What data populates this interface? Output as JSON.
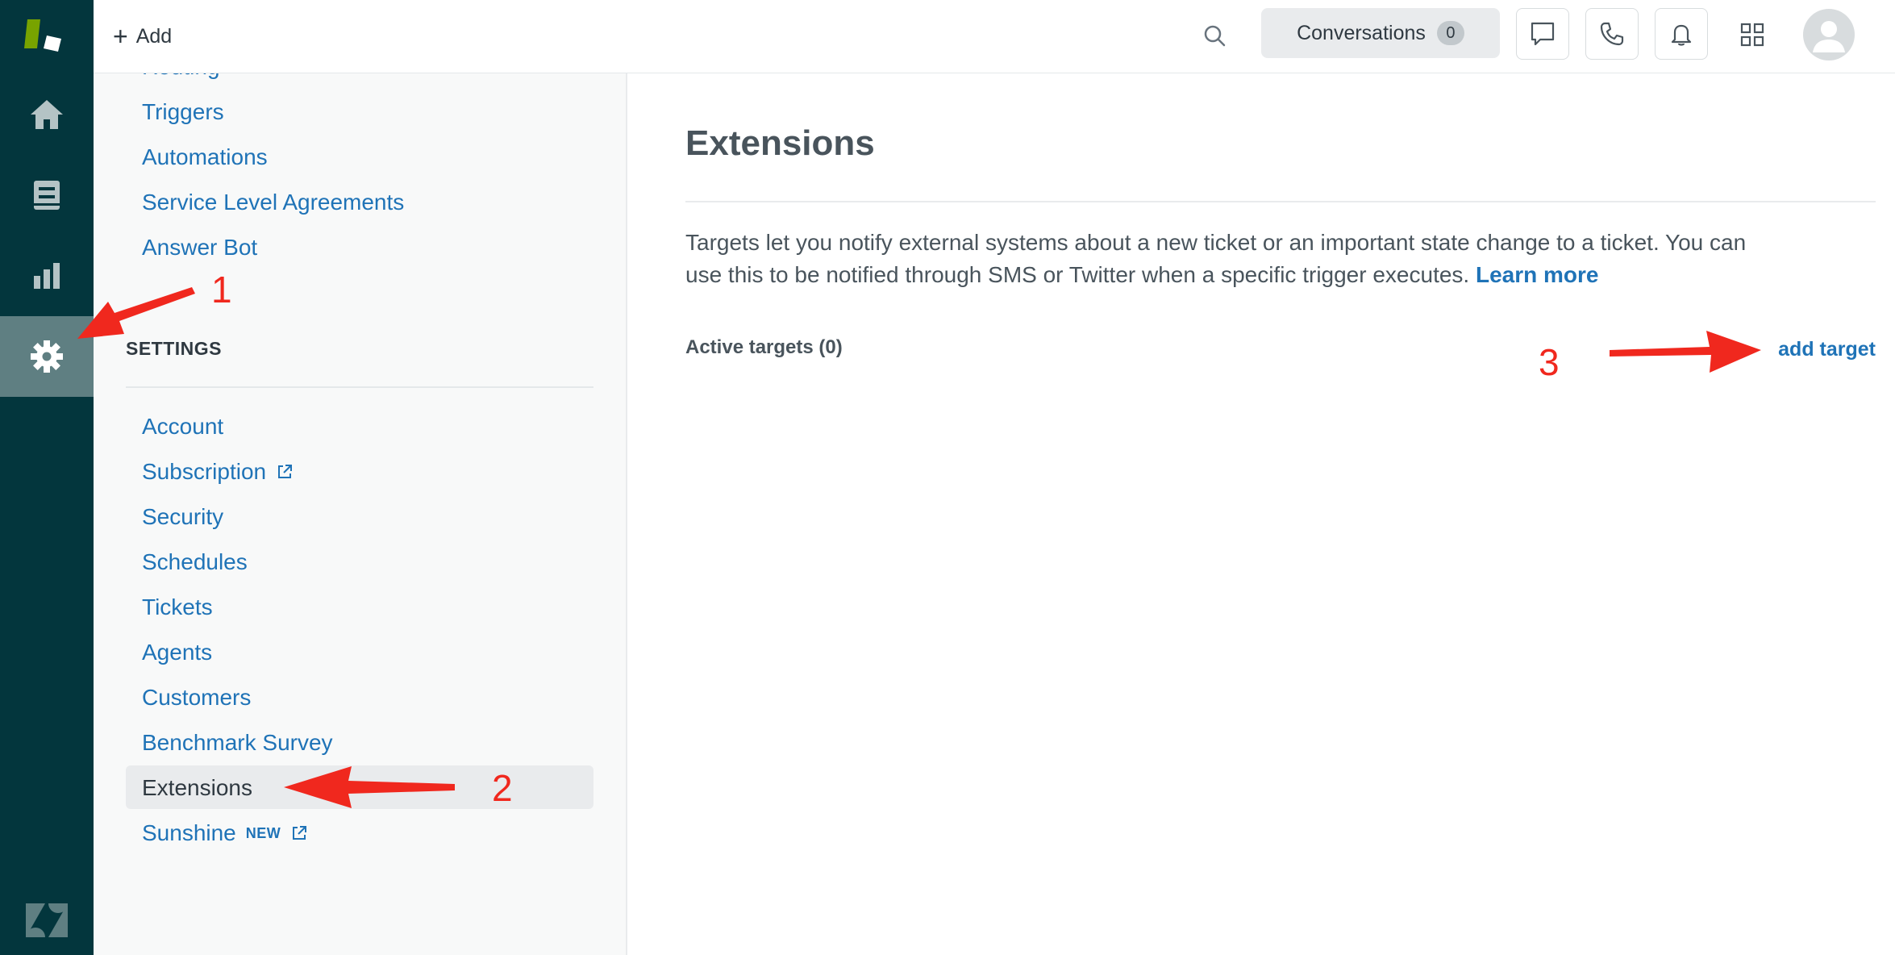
{
  "topbar": {
    "add_label": "Add",
    "conversations_label": "Conversations",
    "conversations_count": "0"
  },
  "rail": {
    "items": [
      "home-icon",
      "views-icon",
      "reporting-icon",
      "admin-gear-icon"
    ],
    "active": "admin-gear-icon"
  },
  "subnav": {
    "partial_item": "Routing",
    "upper_items": [
      "Triggers",
      "Automations",
      "Service Level Agreements",
      "Answer Bot"
    ],
    "section_title": "SETTINGS",
    "settings_items": [
      "Account",
      "Subscription",
      "Security",
      "Schedules",
      "Tickets",
      "Agents",
      "Customers",
      "Benchmark Survey",
      "Extensions",
      "Sunshine"
    ],
    "new_tag": "NEW",
    "current": "Extensions"
  },
  "main": {
    "title": "Extensions",
    "description": "Targets let you notify external systems about a new ticket or an important state change to a ticket. You can use this to be notified through SMS or Twitter when a specific trigger executes.",
    "learn_more": "Learn more",
    "active_targets": "Active targets (0)",
    "add_target": "add target"
  },
  "annotations": {
    "step1": "1",
    "step2": "2",
    "step3": "3",
    "color": "#f0281e"
  },
  "colors": {
    "rail_bg": "#03363d",
    "rail_active": "#5f7f82",
    "link": "#1f73b7",
    "logo_green": "#78a300"
  }
}
